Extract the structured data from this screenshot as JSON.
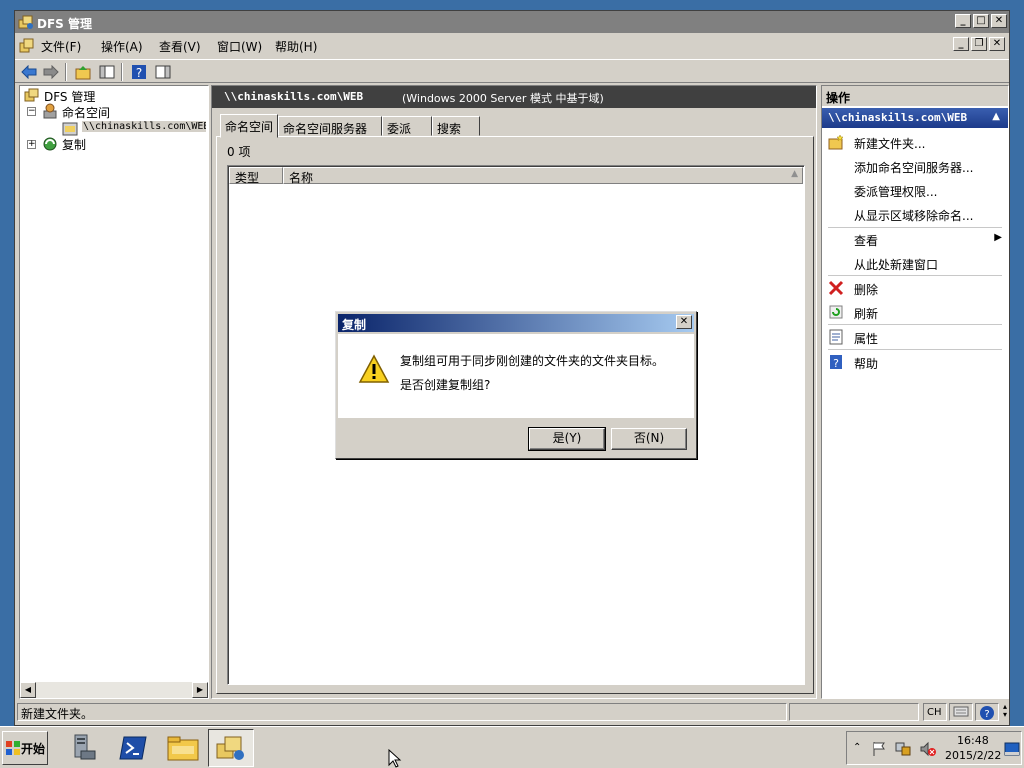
{
  "window": {
    "title": "DFS 管理"
  },
  "menu": [
    "文件(F)",
    "操作(A)",
    "查看(V)",
    "窗口(W)",
    "帮助(H)"
  ],
  "tree": {
    "root": "DFS 管理",
    "namespaces": "命名空间",
    "namespace_item": "\\\\chinaskills.com\\WEB",
    "replication": "复制"
  },
  "center": {
    "header_path": "\\\\chinaskills.com\\WEB",
    "header_mode": "(Windows 2000 Server 模式 中基于域)",
    "tabs": [
      "命名空间",
      "命名空间服务器",
      "委派",
      "搜索"
    ],
    "item_count": "0 项",
    "columns": [
      "类型",
      "名称"
    ]
  },
  "actions": {
    "title": "操作",
    "subtitle": "\\\\chinaskills.com\\WEB",
    "items": [
      "新建文件夹...",
      "添加命名空间服务器...",
      "委派管理权限...",
      "从显示区域移除命名...",
      "查看",
      "从此处新建窗口",
      "删除",
      "刷新",
      "属性",
      "帮助"
    ]
  },
  "status": {
    "text": "新建文件夹。",
    "lang": "CH"
  },
  "dialog": {
    "title": "复制",
    "line1": "复制组可用于同步刚创建的文件夹的文件夹目标。",
    "line2": "是否创建复制组?",
    "yes": "是(Y)",
    "no": "否(N)"
  },
  "taskbar": {
    "start": "开始",
    "time": "16:48",
    "date": "2015/2/22"
  }
}
